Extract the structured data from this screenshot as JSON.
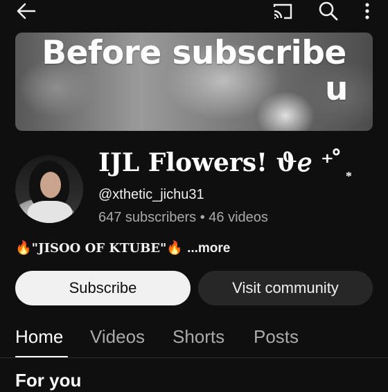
{
  "topbar": {
    "icons": [
      "back-arrow-icon",
      "cast-icon",
      "search-icon",
      "more-vert-icon"
    ]
  },
  "banner": {
    "line1": "Before subscribe",
    "line2": "u"
  },
  "channel": {
    "name": "IJL Flowers! ϑℯ ⁺ ̊ ͙",
    "handle": "@xthetic_jichu31",
    "stats": "647 subscribers • 46 videos",
    "description_fire_left": "🔥",
    "description": "\"JISOO OF KTUBE\"",
    "description_fire_right": "🔥",
    "more_label": "...more"
  },
  "actions": {
    "subscribe_label": "Subscribe",
    "community_label": "Visit community"
  },
  "tabs": [
    {
      "label": "Home",
      "active": true
    },
    {
      "label": "Videos",
      "active": false
    },
    {
      "label": "Shorts",
      "active": false
    },
    {
      "label": "Posts",
      "active": false
    }
  ],
  "section": {
    "title": "For you"
  }
}
